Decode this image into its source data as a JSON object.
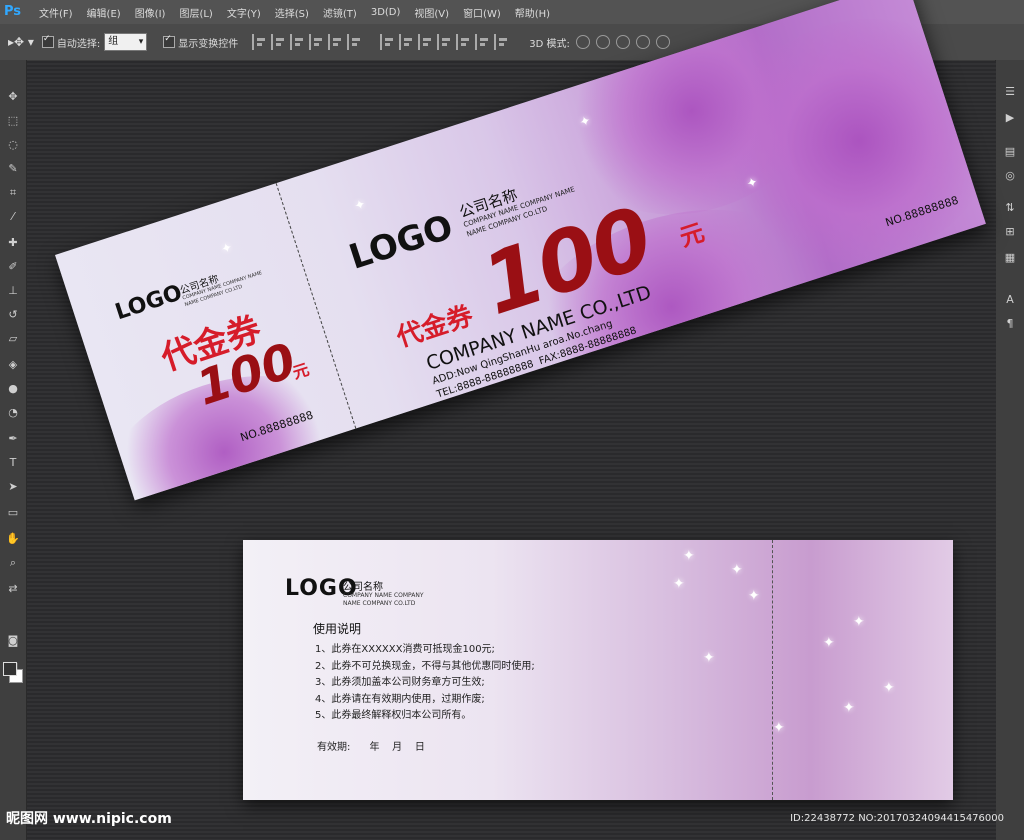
{
  "app": {
    "logo": "Ps",
    "menu": [
      "文件(F)",
      "编辑(E)",
      "图像(I)",
      "图层(L)",
      "文字(Y)",
      "选择(S)",
      "滤镜(T)",
      "3D(D)",
      "视图(V)",
      "窗口(W)",
      "帮助(H)"
    ]
  },
  "options": {
    "auto_select_label": "自动选择:",
    "auto_select_value": "组",
    "show_transform_label": "显示变换控件",
    "mode_3d_label": "3D 模式:"
  },
  "voucher_front": {
    "stub": {
      "logo": "LOGO",
      "company": "公司名称",
      "company_en1": "COMPANY NAME COMPANY NAME",
      "company_en2": "NAME COMPANY CO.LTD",
      "title": "代金券",
      "amount": "100",
      "unit": "元",
      "number": "NO.88888888"
    },
    "main": {
      "logo": "LOGO",
      "company": "公司名称",
      "company_en1": "COMPANY NAME COMPANY NAME",
      "company_en2": "NAME COMPANY CO.LTD",
      "title": "代金券",
      "amount": "100",
      "unit": "元",
      "company_name": "COMPANY NAME CO.,LTD",
      "address": "ADD:Now QingShanHu aroa.No.chang",
      "tel": "TEL:8888-88888888",
      "fax": "FAX:8888-88888888",
      "number": "NO.88888888"
    }
  },
  "voucher_back": {
    "logo": "LOGO",
    "company": "公司名称",
    "company_en1": "COMPANY NAME COMPANY",
    "company_en2": "NAME COMPANY CO.LTD",
    "usage_title": "使用说明",
    "rules": [
      "1、此券在XXXXXX消费可抵现金100元;",
      "2、此券不可兑换现金，不得与其他优惠同时使用;",
      "3、此券须加盖本公司财务章方可生效;",
      "4、此券请在有效期内使用，过期作废;",
      "5、此券最终解释权归本公司所有。"
    ],
    "validity": "有效期:      年    月    日"
  },
  "footer": {
    "brand": "昵图网 www.nipic.com",
    "id": "ID:22438772 NO:20170324094415476000"
  }
}
